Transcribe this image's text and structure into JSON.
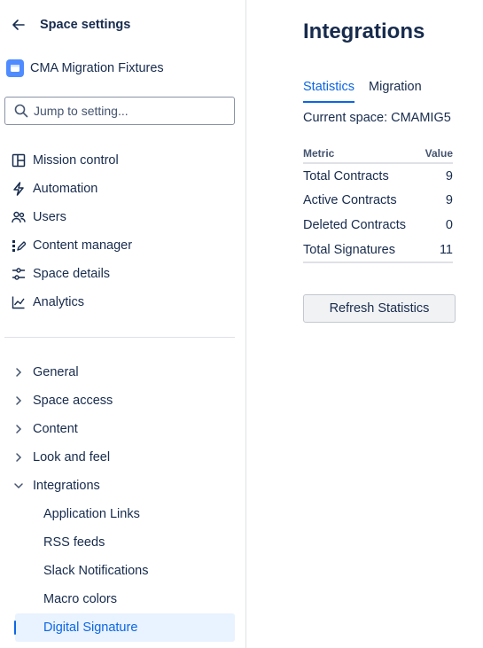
{
  "sidebar": {
    "header_title": "Space settings",
    "space_name": "CMA Migration Fixtures",
    "search_placeholder": "Jump to setting...",
    "nav_items": [
      {
        "label": "Mission control",
        "icon": "layout-icon"
      },
      {
        "label": "Automation",
        "icon": "lightning-icon"
      },
      {
        "label": "Users",
        "icon": "people-icon"
      },
      {
        "label": "Content manager",
        "icon": "content-manager-icon"
      },
      {
        "label": "Space details",
        "icon": "sliders-icon"
      },
      {
        "label": "Analytics",
        "icon": "line-chart-icon"
      }
    ],
    "tree": [
      {
        "label": "General",
        "expanded": false
      },
      {
        "label": "Space access",
        "expanded": false
      },
      {
        "label": "Content",
        "expanded": false
      },
      {
        "label": "Look and feel",
        "expanded": false
      },
      {
        "label": "Integrations",
        "expanded": true
      }
    ],
    "integrations_children": [
      "Application Links",
      "RSS feeds",
      "Slack Notifications",
      "Macro colors",
      "Digital Signature"
    ],
    "selected_item": "Digital Signature"
  },
  "main": {
    "title": "Integrations",
    "tabs": [
      {
        "label": "Statistics",
        "active": true
      },
      {
        "label": "Migration",
        "active": false
      }
    ],
    "current_space": "Current space: CMAMIG5",
    "table": {
      "headers": [
        "Metric",
        "Value"
      ],
      "rows": [
        {
          "metric": "Total Contracts",
          "value": "9"
        },
        {
          "metric": "Active Contracts",
          "value": "9"
        },
        {
          "metric": "Deleted Contracts",
          "value": "0"
        },
        {
          "metric": "Total Signatures",
          "value": "11"
        }
      ]
    },
    "refresh_button": "Refresh Statistics"
  },
  "colors": {
    "accent": "#0c66e4",
    "selected_bg": "#e9f2ff",
    "text": "#172b4d",
    "space_avatar": "#4f8cff"
  }
}
